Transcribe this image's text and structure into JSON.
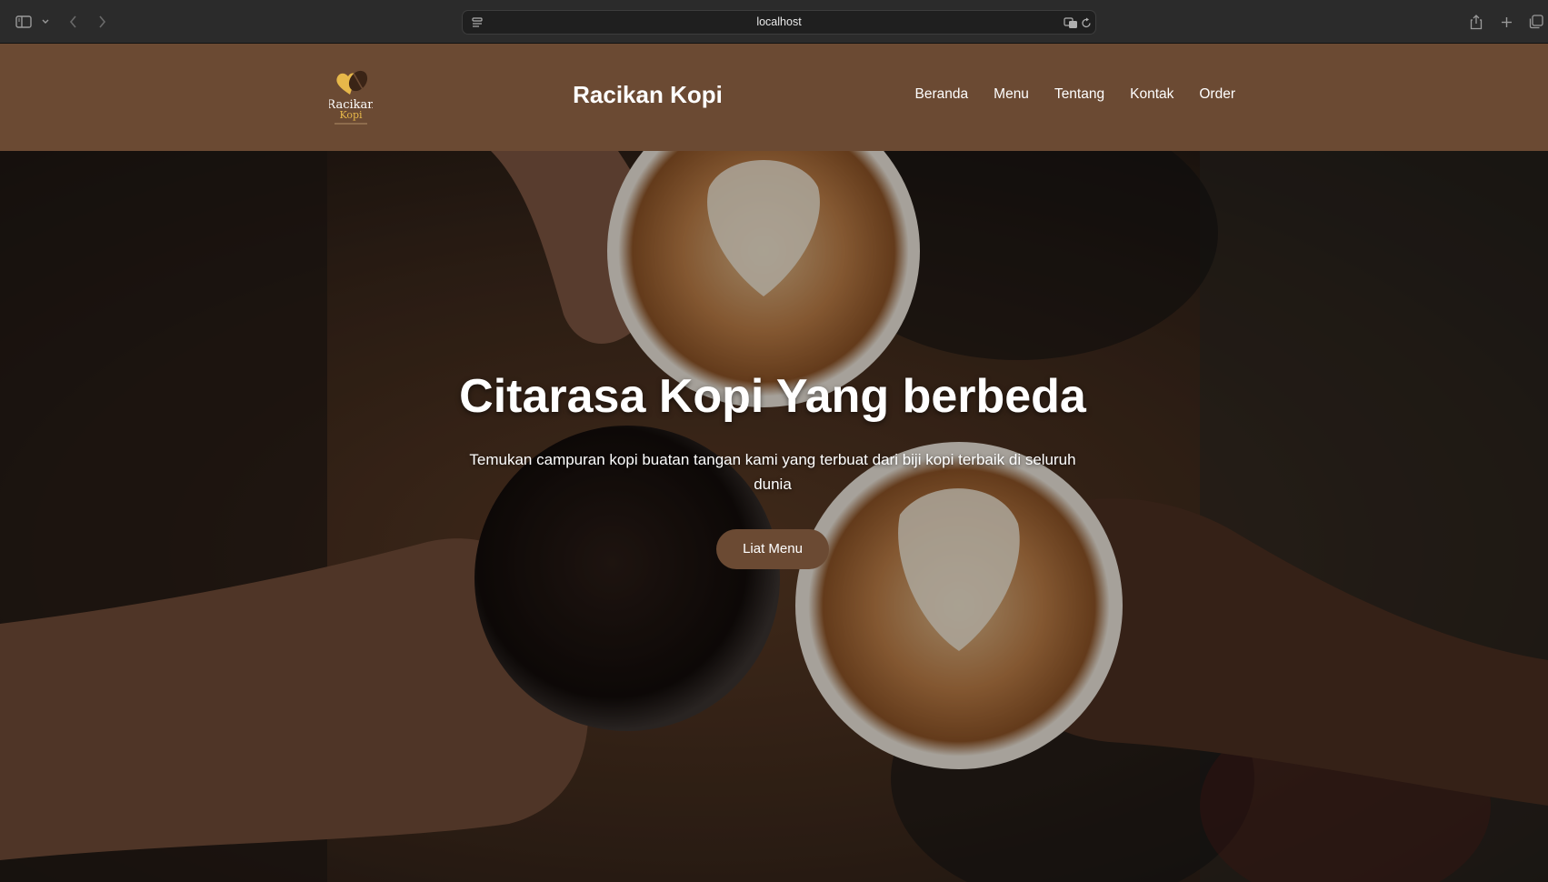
{
  "browser": {
    "url": "localhost",
    "icons": [
      "sidebar-icon",
      "chevron-down-icon",
      "back-arrow-icon",
      "forward-arrow-icon",
      "page-settings-icon",
      "translate-icon",
      "reload-icon",
      "share-icon",
      "new-tab-icon",
      "tab-overview-icon"
    ]
  },
  "header": {
    "logo_text_line1": "Racikan",
    "logo_text_line2": "Kopi",
    "title": "Racikan Kopi",
    "nav": [
      "Beranda",
      "Menu",
      "Tentang",
      "Kontak",
      "Order"
    ]
  },
  "hero": {
    "title": "Citarasa Kopi Yang berbeda",
    "subtitle": "Temukan campuran kopi buatan tangan kami yang terbuat dari biji kopi terbaik di seluruh dunia",
    "cta_label": "Liat Menu"
  },
  "colors": {
    "header_bg": "#6b4a33",
    "button_bg": "#6b4a33",
    "logo_gold": "#e7b84a",
    "text": "#ffffff"
  }
}
